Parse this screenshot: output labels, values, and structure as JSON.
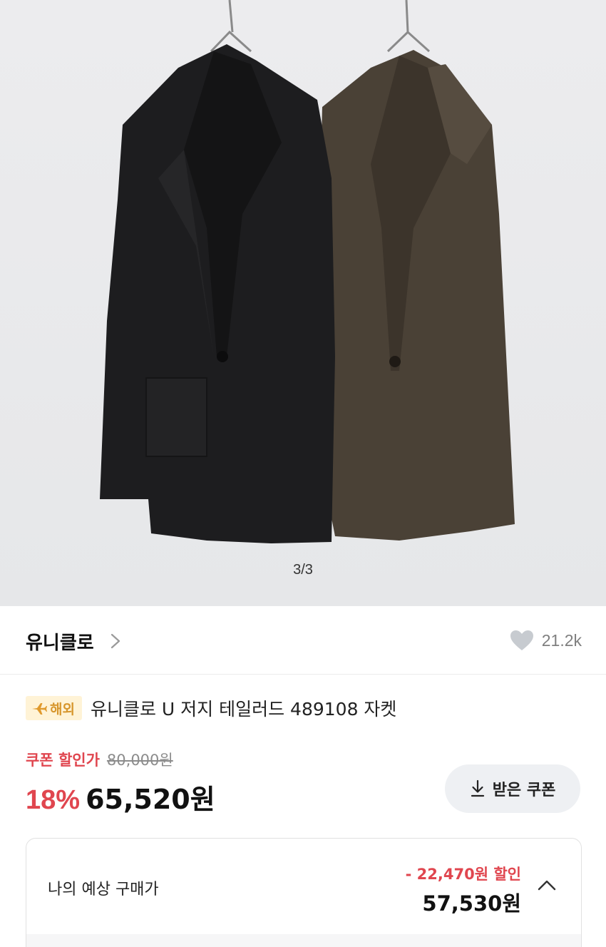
{
  "product_image": {
    "counter": "3/3"
  },
  "brand": {
    "name": "유니클로",
    "like_count": "21.2k"
  },
  "product": {
    "badge_label": "해외",
    "title": "유니클로 U 저지 테일러드 489108 자켓"
  },
  "price": {
    "coupon_label": "쿠폰 할인가",
    "original_price": "80,000원",
    "discount_rate": "18%",
    "sale_price": "65,520원",
    "coupon_button_label": "받은 쿠폰"
  },
  "estimate": {
    "label": "나의 예상 구매가",
    "discount_text": "- 22,470원 할인",
    "final_price": "57,530원"
  },
  "colors": {
    "accent_red": "#e0464f",
    "badge_bg": "#fff3d6",
    "badge_text": "#d7962c"
  },
  "icons": [
    "chevron-right-icon",
    "heart-icon",
    "plane-icon",
    "download-icon",
    "chevron-up-icon"
  ]
}
